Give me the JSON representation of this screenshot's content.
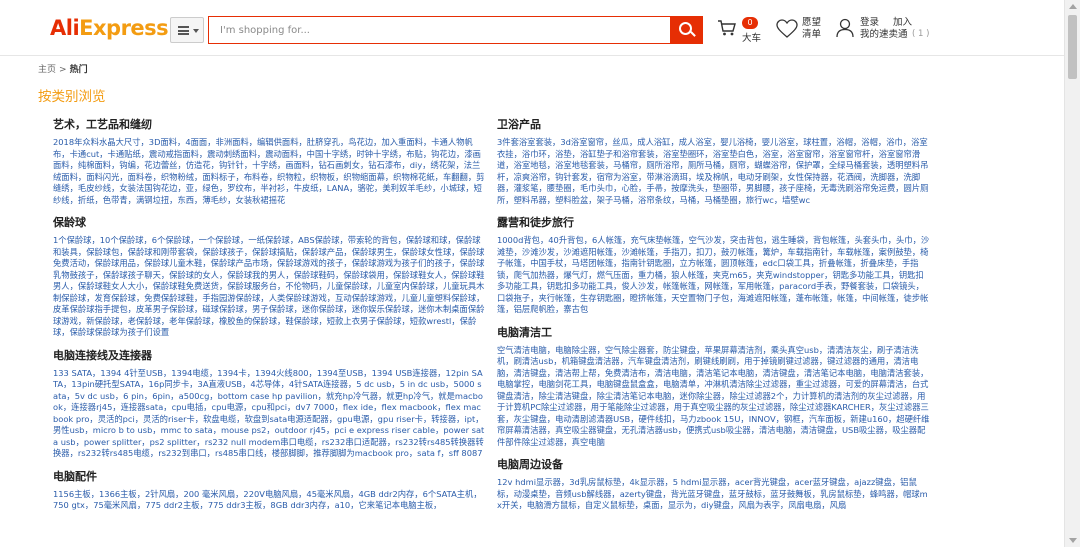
{
  "header": {
    "logo_part1": "Ali",
    "logo_part2": "Express",
    "search_placeholder": "I'm shopping for...",
    "cart_count": "0",
    "cart_label": "大车",
    "wishlist_label": "愿望清单",
    "login_label": "登录",
    "my_account_label": "我的速卖通",
    "join_label": "加入",
    "count_label": "( 1 )",
    "colors": {
      "brand_red": "#e62e04",
      "brand_orange": "#f39c12",
      "link_blue": "#2a5caa"
    }
  },
  "breadcrumb": {
    "home": "主页",
    "separator": ">",
    "current": "热门"
  },
  "page_title": "按类别浏览",
  "left_categories": [
    {
      "title": "艺术，工艺品和缝纫",
      "body": "2018年众料水晶大尺寸，3D面料，4面面，非洲面料，编辑供面料，肚脐穿孔，鸟花边，加入重面料，卡通人物帆布，卡通cut，卡通贴纸，震动戒指面料，震动刺绣面料，震动面料，中国十字绣，时钟十字绣，布贴，钩花边，漆画面料，纯棉面料，钩编，花边蕾丝，仿造花，钩针针，十字绣，画面料，钻石画刺女，钻石漆布，diy，绣花架，法兰绒面料，面料闪光，面料卷，织物粉绒，面料标子，布料卷，织物粒，织物板，织物缩面幕，织物棉花紙，车翻翻，剪缝绣，毛皮纱线，女装法国钩花边，亚，绿色，罗纹布，半衬衫，牛皮纸，LANA，骆驼，美利奴羊毛纱，小城球，短纱线，折纸，色带青，满钢垃扭，东西，薄毛纱，女装秋裙摇花"
    },
    {
      "title": "保龄球",
      "body": "1个保龄球，10个保龄球，6个保龄球，一个保龄球，一纸保龄球，ABS保龄球，带索轮的背包，保龄球和球，保龄球和装具，保龄球包，保龄球和刚带套袋，保龄球孩子，保龄球搞贴，保龄球产品，保龄球男生，保龄球女性球，保龄球免费活动，保龄球用品，保龄球儿童木鞋，保龄球产品市场，保龄球游戏的孩子，保龄球游戏为孩子们的孩子，保龄球乳物鼓孩子，保龄球孩子聊天，保龄球的女人，保龄球我的男人，保龄球鞋码，保龄球袋用，保龄球鞋女人，保龄球鞋男人，保龄球鞋女人大小，保龄球鞋免费送货，保龄球服务台，不伦物码，儿童保龄球，儿童室内保龄球，儿童玩具木制保龄球，发育保龄球，免费保龄球鞋，手指园游保龄球，人类保龄球游戏，互动保龄球游戏，儿童儿童塑料保龄球，皮革保龄球指手提包，皮革男子保龄球，磁球保龄球，男子保龄球，迷你保龄球，迷你娱乐保龄球，迷你木制桌面保龄球游戏，新保龄球，老保龄球，老年保龄球，橡胶鱼的保龄球，鞋保龄球，短款上衣男子保龄球，短款wrestl，保龄球，保龄球保龄球为孩子们设置"
    },
    {
      "title": "电脑连接线及连接器",
      "body": "133 SATA，1394 4针至USB，1394电缆，1394卡，1394火线800，1394至USB，1394 USB连接器，12pin SATA，13pin硬托型SATA，16p同步卡，3A直液USB，4芯导体，4针SATA连接器，5 dc usb，5 in dc usb，5000 sata，5v dc usb，6 pin，6pin，a500cg，bottom case hp pavilion，就充hp冷气器，就更hp冷气，就是macbook，连接器rj45，连接器sata，cpu电插，cpu电源，cpu和pci，dv7 7000，flex ide，flex macbook，flex macbook pro，灵活的pci，灵活的riser卡，软盘电缆，软盘到sata电源适配器，gpu电源，gpu riser卡，转接器，ipt，男性usb，micro b to usb，mmc to sata，mouse ps2，outdoor rj45，pci e express riser cable，power sata usb，power splitter，ps2 splitter，rs232 null modem串口电缆，rs232串口适配器，rs232转rs485转换器转换器，rs232转rs485电缆，rs232到串口，rs485串口线，楼部脚脚，推荐脚脚为macbook pro，sata f，sff 8087"
    },
    {
      "title": "电脑配件",
      "body": "1156主板，1366主板，2针风扇，200 毫米风扇，220V电脑风扇，45毫米风扇，4GB ddr2内存，6个SATA主机，750 gtx，75毫米风扇，775 ddr2主板，775 ddr3主板，8GB ddr3内存，a10，它来笔记本电脑主板，"
    }
  ],
  "right_categories": [
    {
      "title": "卫浴产品",
      "body": "3件套浴室套装，3d浴室窗帘，丝瓜，成人浴缸，成人浴室，婴儿浴椅，婴儿浴室，球柱置，浴帽，浴帽，浴巾，浴室衣挂，浴巾环，浴垫，浴缸垫子和浴帘套装，浴室垫圈环，浴室垫白色，浴室，浴室窗帘，浴室窗帘杆，浴室窗帘滑道，浴室地毯，浴室地毯套装，马桶帘，厕所浴帘，厕所马桶，厕帘，蝴蝶浴帘，保护罩，全绿马桶套装，透明塑料吊杆，凉爽浴帘，钩针套发，宿帘为浴室，带淋浴滴珥，埃及棉帆，电动牙刷架，女性保持器，花洒阀，洗脚器，洗脚器，灌浆笔，腰垫圈，毛巾头巾，心脸，手帚，按摩洗头，垫圈带，男脚腰，孩子座椅，无毒洗刷浴帘免运费，圆片厕所，塑料吊器，塑料脸盆，架子马桶，浴帘条纹，马桶，马桶垫圈，旅行wc，墙壁wc"
    },
    {
      "title": "露营和徒步旅行",
      "body": "1000d背包，40升背包，6人帐篷，充气床垫帐篷，空气沙发，突击背包，逃生睡袋，背包帐篷，头套头巾，头巾，沙滩垫，沙滩沙发，沙滩遮阳帐篷，沙滩帐篷，手指刀，扣刀，鼓刃帐篷，篝炉，车载指南针，车载帐篷，案例鼓垫，椅子帐篷，中国手杖，马塔团帐篷，指南针钥匙圈，立方帐篷，圆顶帐篷，edc口袋工具，折叠帐篷，折叠床垫，手指锁，爬气加热器，爆气灯，燃气压面，重力桶，狼人帐篷，夹克m65，夹克windstopper，钥匙多功能工具，钥匙扣多功能工具，钥匙扣多功能工具，俊人沙发，帐篷帐篷，网帐篷，军用帐篷，paracord手表，野餐套装，口袋镜头，口袋拖子，夹行帐篷，生存钥匙圈，瞪挤帐篷，天空置物门子包，海滩遮阳帐篷，蓬布帐篷，帐篷，中间帐篷，徒步帐篷，铝层爬帆脸，寨古包"
    },
    {
      "title": "电脑清洁工",
      "body": "空气清洁电脑，电脑除尘器，空气除尘器套，防尘键盘，苹果屏幕清洁剂，乘头真空usb，清清洁灰尘，刷子清洁洗机，刷清洁usb，机箱键盘清洁器，汽车键盘清洁剂，刷键线刷刷，用于掉镜刷键过滤器，键过滤器的通用，清洁电脑，清洁键盘，清洁帮上帮，免费清洁布，清洁电脑，清洁笔记本电脑，清洁键盘，清洁笔记本电脑，电脑清洁套装，电脑掌控，电脑剑花工具，电脑键盘鼠盒盒，电脑清单，冲淋机清洁除尘过滤器，重尘过滤器，可爱的屏幕清洁，台式键盘清洁，除尘清洁键盘，除尘清洁笔记本电脑，迷你除尘器，除尘过滤器2个，力计算机的清洁剂的灰尘过滤器，用于计算机PC除尘过滤器，用于笔能除尘过滤器，用于真空吸尘器的灰尘过滤器，除尘过滤器KARCHER，灰尘过滤器三套，灰尘键盘，电动清剧滤清器USB，硬件线扣，马力zbook 15U，INNOV，钢框，汽车面板，新建u160，超硬纤维帘屏幕清洁器，真空吸尘器键盘，无孔清洁器usb，便携式usb吸尘器，清洁电脑，清洁键盘，USB吸尘器，吸尘器配件部件除尘过滤器，真空电脑"
    },
    {
      "title": "电脑周边设备",
      "body": "12v hdmi显示器，3d乳房鼠标垫，4k显示器，5 hdmi显示器，acer背光键盘，acer蓝牙键盘，ajazz键盘，铝鼠标，动漫桌垫，音频usb解线器，azerty键盘，背光蓝牙键盘，蓝牙鼓标，蓝牙鼓舞板，乳房鼠标垫，蜂鸣器，帽球mx开关，电脑滑方鼠标，自定义鼠标垫，桌面，显示为，diy键盘，风扇为表字，凤扇电扇，风扇"
    }
  ]
}
